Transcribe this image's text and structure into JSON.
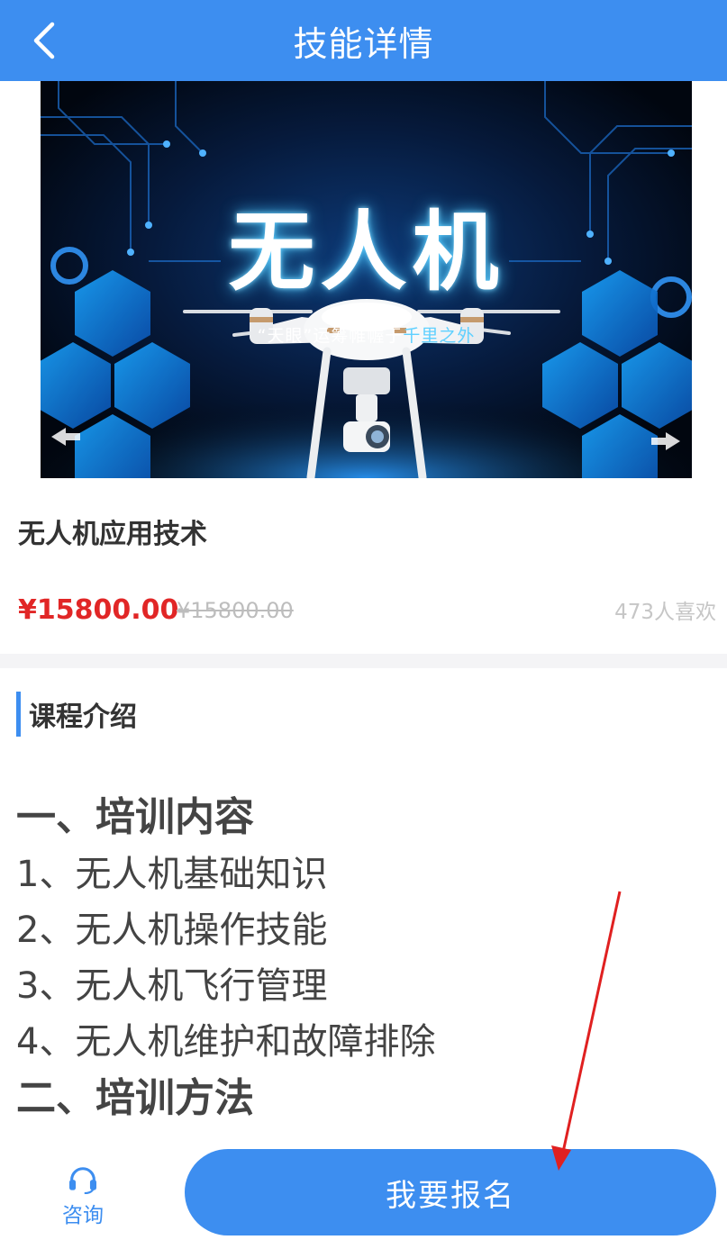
{
  "header": {
    "title": "技能详情",
    "back_icon": "chevron-left-icon"
  },
  "banner": {
    "title": "无人机",
    "subtitle_prefix": "“天眼”运筹帷幄于",
    "subtitle_highlight": "千里之外"
  },
  "product": {
    "name": "无人机应用技术",
    "price": "¥15800.00",
    "original_price": "¥15800.00",
    "likes": "473人喜欢"
  },
  "section": {
    "title": "课程介绍",
    "content": [
      {
        "type": "heading",
        "text": "一、培训内容"
      },
      {
        "type": "item",
        "text": "1、无人机基础知识"
      },
      {
        "type": "item",
        "text": "2、无人机操作技能"
      },
      {
        "type": "item",
        "text": "3、无人机飞行管理"
      },
      {
        "type": "item",
        "text": "4、无人机维护和故障排除"
      },
      {
        "type": "heading",
        "text": "二、培训方法"
      }
    ]
  },
  "bottom": {
    "consult_label": "咨询",
    "consult_icon": "headset-icon",
    "signup_label": "我要报名"
  },
  "colors": {
    "primary": "#3d8ef0",
    "price": "#e12626",
    "annotation_arrow": "#e02020"
  }
}
